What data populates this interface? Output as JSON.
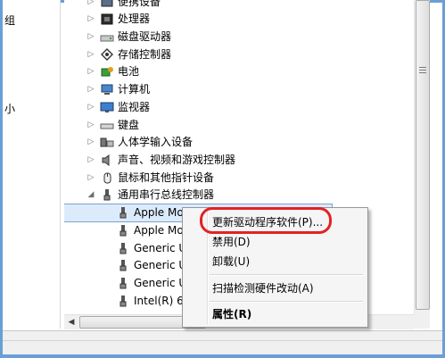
{
  "left_pane": {
    "text_top": "组",
    "text_mid": "小"
  },
  "tree": {
    "items": [
      {
        "label": "便携设备",
        "icon": "portable-device-icon",
        "expanded": false
      },
      {
        "label": "处理器",
        "icon": "cpu-icon",
        "expanded": false
      },
      {
        "label": "磁盘驱动器",
        "icon": "disk-drive-icon",
        "expanded": false
      },
      {
        "label": "存储控制器",
        "icon": "storage-controller-icon",
        "expanded": false
      },
      {
        "label": "电池",
        "icon": "battery-icon",
        "expanded": false
      },
      {
        "label": "计算机",
        "icon": "computer-icon",
        "expanded": false
      },
      {
        "label": "监视器",
        "icon": "monitor-icon",
        "expanded": false
      },
      {
        "label": "键盘",
        "icon": "keyboard-icon",
        "expanded": false
      },
      {
        "label": "人体学输入设备",
        "icon": "hid-icon",
        "expanded": false
      },
      {
        "label": "声音、视频和游戏控制器",
        "icon": "speaker-icon",
        "expanded": false
      },
      {
        "label": "鼠标和其他指针设备",
        "icon": "mouse-icon",
        "expanded": false
      },
      {
        "label": "通用串行总线控制器",
        "icon": "usb-icon",
        "expanded": true
      }
    ],
    "children": [
      {
        "label": "Apple Mo"
      },
      {
        "label": "Apple Mo"
      },
      {
        "label": "Generic U"
      },
      {
        "label": "Generic U"
      },
      {
        "label": "Generic U"
      },
      {
        "label": "Intel(R) 6"
      }
    ]
  },
  "context_menu": {
    "items": [
      {
        "label": "更新驱动程序软件(P)...",
        "bold": false
      },
      {
        "label": "禁用(D)",
        "bold": false
      },
      {
        "label": "卸载(U)",
        "bold": false
      },
      {
        "label": "扫描检测硬件改动(A)",
        "bold": false
      },
      {
        "label": "属性(R)",
        "bold": true
      }
    ]
  },
  "colors": {
    "frame": "#6b9ed6",
    "highlight_ring": "#e32222",
    "menu_bg": "#f5f5f5"
  }
}
